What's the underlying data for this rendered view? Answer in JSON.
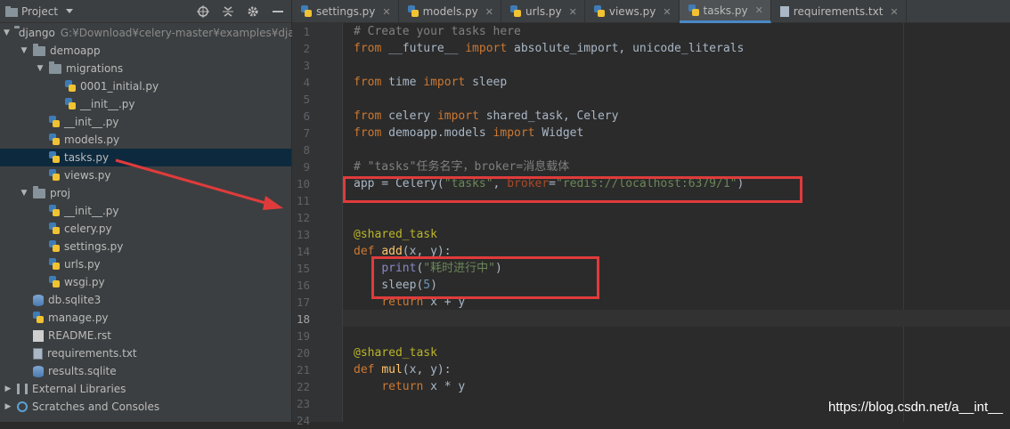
{
  "project_panel": {
    "title": "Project",
    "tree": [
      {
        "label": "django",
        "note": "G:¥Download¥celery-master¥examples¥djang",
        "type": "folder",
        "expanded": true,
        "depth": 0
      },
      {
        "label": "demoapp",
        "type": "folder",
        "expanded": true,
        "depth": 1
      },
      {
        "label": "migrations",
        "type": "folder",
        "expanded": true,
        "depth": 2
      },
      {
        "label": "0001_initial.py",
        "type": "py",
        "depth": 3
      },
      {
        "label": "__init__.py",
        "type": "py",
        "depth": 3
      },
      {
        "label": "__init__.py",
        "type": "py",
        "depth": 2
      },
      {
        "label": "models.py",
        "type": "py",
        "depth": 2
      },
      {
        "label": "tasks.py",
        "type": "py",
        "depth": 2,
        "selected": true
      },
      {
        "label": "views.py",
        "type": "py",
        "depth": 2
      },
      {
        "label": "proj",
        "type": "folder",
        "expanded": true,
        "depth": 1
      },
      {
        "label": "__init__.py",
        "type": "py",
        "depth": 2
      },
      {
        "label": "celery.py",
        "type": "py",
        "depth": 2
      },
      {
        "label": "settings.py",
        "type": "py",
        "depth": 2
      },
      {
        "label": "urls.py",
        "type": "py",
        "depth": 2
      },
      {
        "label": "wsgi.py",
        "type": "py",
        "depth": 2
      },
      {
        "label": "db.sqlite3",
        "type": "db",
        "depth": 1
      },
      {
        "label": "manage.py",
        "type": "py",
        "depth": 1
      },
      {
        "label": "README.rst",
        "type": "rst",
        "depth": 1
      },
      {
        "label": "requirements.txt",
        "type": "txt",
        "depth": 1
      },
      {
        "label": "results.sqlite",
        "type": "db",
        "depth": 1
      },
      {
        "label": "External Libraries",
        "type": "lib",
        "expanded": false,
        "depth": 0
      },
      {
        "label": "Scratches and Consoles",
        "type": "scratch",
        "expanded": false,
        "depth": 0
      }
    ]
  },
  "tabs": [
    {
      "label": "settings.py",
      "type": "py"
    },
    {
      "label": "models.py",
      "type": "py"
    },
    {
      "label": "urls.py",
      "type": "py"
    },
    {
      "label": "views.py",
      "type": "py"
    },
    {
      "label": "tasks.py",
      "type": "py",
      "active": true
    },
    {
      "label": "requirements.txt",
      "type": "txt"
    }
  ],
  "editor": {
    "current_line": 18,
    "line_numbers": [
      "1",
      "2",
      "3",
      "4",
      "5",
      "6",
      "7",
      "8",
      "9",
      "10",
      "11",
      "12",
      "13",
      "14",
      "15",
      "16",
      "17",
      "18",
      "19",
      "20",
      "21",
      "22",
      "23",
      "24"
    ],
    "lines": [
      [
        {
          "t": "# Create your tasks here",
          "c": "comment"
        }
      ],
      [
        {
          "t": "from ",
          "c": "kw"
        },
        {
          "t": "__future__ ",
          "c": "plain"
        },
        {
          "t": "import ",
          "c": "kw"
        },
        {
          "t": "absolute_import, unicode_literals",
          "c": "plain"
        }
      ],
      [],
      [
        {
          "t": "from ",
          "c": "kw"
        },
        {
          "t": "time ",
          "c": "plain"
        },
        {
          "t": "import ",
          "c": "kw"
        },
        {
          "t": "sleep",
          "c": "plain"
        }
      ],
      [],
      [
        {
          "t": "from ",
          "c": "kw"
        },
        {
          "t": "celery ",
          "c": "plain"
        },
        {
          "t": "import ",
          "c": "kw"
        },
        {
          "t": "shared_task, Celery",
          "c": "plain"
        }
      ],
      [
        {
          "t": "from ",
          "c": "kw"
        },
        {
          "t": "demoapp.models ",
          "c": "plain"
        },
        {
          "t": "import ",
          "c": "kw"
        },
        {
          "t": "Widget",
          "c": "plain"
        }
      ],
      [],
      [
        {
          "t": "# \"tasks\"任务名字，broker=消息载体",
          "c": "comment"
        }
      ],
      [
        {
          "t": "app = Celery(",
          "c": "plain"
        },
        {
          "t": "\"tasks\"",
          "c": "str"
        },
        {
          "t": ", ",
          "c": "plain"
        },
        {
          "t": "broker",
          "c": "param"
        },
        {
          "t": "=",
          "c": "plain"
        },
        {
          "t": "\"redis://localhost:6379/1\"",
          "c": "str"
        },
        {
          "t": ")",
          "c": "plain"
        }
      ],
      [],
      [],
      [
        {
          "t": "@shared_task",
          "c": "dec"
        }
      ],
      [
        {
          "t": "def ",
          "c": "kw"
        },
        {
          "t": "add",
          "c": "fn"
        },
        {
          "t": "(x, y):",
          "c": "plain"
        }
      ],
      [
        {
          "t": "    ",
          "c": "plain"
        },
        {
          "t": "print",
          "c": "builtin"
        },
        {
          "t": "(",
          "c": "plain"
        },
        {
          "t": "\"耗时进行中\"",
          "c": "str"
        },
        {
          "t": ")",
          "c": "plain"
        }
      ],
      [
        {
          "t": "    sleep(",
          "c": "plain"
        },
        {
          "t": "5",
          "c": "num"
        },
        {
          "t": ")",
          "c": "plain"
        }
      ],
      [
        {
          "t": "    ",
          "c": "plain"
        },
        {
          "t": "return ",
          "c": "kw"
        },
        {
          "t": "x + y",
          "c": "plain"
        }
      ],
      [],
      [],
      [
        {
          "t": "@shared_task",
          "c": "dec"
        }
      ],
      [
        {
          "t": "def ",
          "c": "kw"
        },
        {
          "t": "mul",
          "c": "fn"
        },
        {
          "t": "(x, y):",
          "c": "plain"
        }
      ],
      [
        {
          "t": "    ",
          "c": "plain"
        },
        {
          "t": "return ",
          "c": "kw"
        },
        {
          "t": "x * y",
          "c": "plain"
        }
      ],
      [],
      []
    ]
  },
  "watermark": "https://blog.csdn.net/a__int__",
  "colors": {
    "annotation_red": "#e03b3b",
    "selection_blue": "#0d293e",
    "active_tab_underline": "#4a88c7"
  }
}
